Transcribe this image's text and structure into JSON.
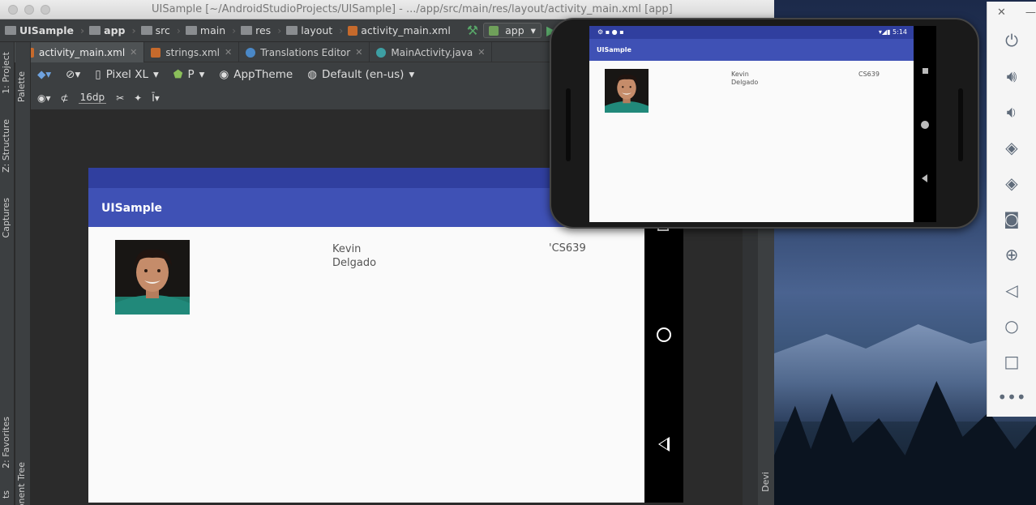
{
  "window": {
    "title": "UISample [~/AndroidStudioProjects/UISample] - .../app/src/main/res/layout/activity_main.xml [app]"
  },
  "breadcrumb": [
    {
      "label": "UISample"
    },
    {
      "label": "app"
    },
    {
      "label": "src"
    },
    {
      "label": "main"
    },
    {
      "label": "res"
    },
    {
      "label": "layout"
    },
    {
      "label": "activity_main.xml"
    }
  ],
  "run_config": {
    "label": "app"
  },
  "tabs": [
    {
      "label": "activity_main.xml"
    },
    {
      "label": "strings.xml"
    },
    {
      "label": "Translations Editor"
    },
    {
      "label": "MainActivity.java"
    }
  ],
  "left_tools": {
    "project": "1: Project",
    "structure": "Z: Structure",
    "captures": "Captures",
    "favorites": "2: Favorites",
    "build_variants": "ts",
    "palette": "Palette",
    "component_tree": "onent Tree"
  },
  "right_tools": {
    "device": "Devi"
  },
  "designer": {
    "device": "Pixel XL",
    "api": "P",
    "theme": "AppTheme",
    "locale": "Default (en-us)",
    "margin": "16dp"
  },
  "design_preview": {
    "app_title": "UISample",
    "name": "Kevin\nDelgado",
    "course": "'CS639"
  },
  "emulator": {
    "status_time": "5:14",
    "app_title": "UISample",
    "name": "Kevin\nDelgado",
    "course": "CS639"
  },
  "colors": {
    "primary": "#3f51b5",
    "primary_dark": "#303f9f",
    "ide_bg": "#3c3f41"
  }
}
